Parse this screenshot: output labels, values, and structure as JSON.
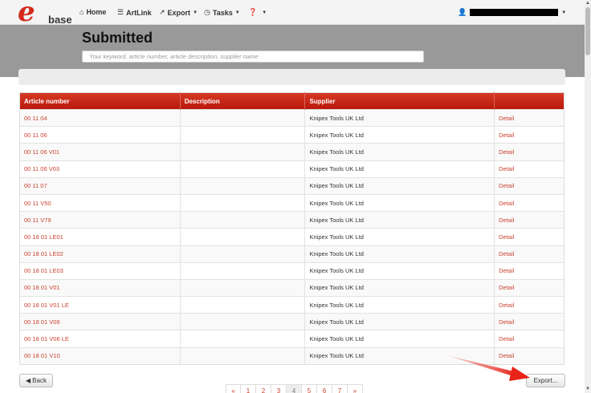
{
  "nav": {
    "logo_mark": "e",
    "logo_text": "base",
    "items": [
      {
        "icon": "home-icon",
        "label": "Home",
        "caret": false
      },
      {
        "icon": "list-icon",
        "label": "ArtLink",
        "caret": false
      },
      {
        "icon": "export-icon",
        "label": "Export",
        "caret": true
      },
      {
        "icon": "clock-icon",
        "label": "Tasks",
        "caret": true
      },
      {
        "icon": "help-icon",
        "label": "",
        "caret": true
      }
    ]
  },
  "page": {
    "title": "Submitted",
    "search_placeholder": "Your keyword, article number, article description, supplier name"
  },
  "table": {
    "headers": [
      "Article number",
      "Description",
      "Supplier",
      ""
    ],
    "detail_label": "Detail",
    "rows": [
      {
        "article": "00 11 04",
        "description": "",
        "supplier": "Knipex Tools UK Ltd"
      },
      {
        "article": "00 11 06",
        "description": "",
        "supplier": "Knipex Tools UK Ltd"
      },
      {
        "article": "00 11 06 V01",
        "description": "",
        "supplier": "Knipex Tools UK Ltd"
      },
      {
        "article": "00 11 06 V03",
        "description": "",
        "supplier": "Knipex Tools UK Ltd"
      },
      {
        "article": "00 11 07",
        "description": "",
        "supplier": "Knipex Tools UK Ltd"
      },
      {
        "article": "00 11 V50",
        "description": "",
        "supplier": "Knipex Tools UK Ltd"
      },
      {
        "article": "00 11 V79",
        "description": "",
        "supplier": "Knipex Tools UK Ltd"
      },
      {
        "article": "00 18 01 LE01",
        "description": "",
        "supplier": "Knipex Tools UK Ltd"
      },
      {
        "article": "00 18 01 LE02",
        "description": "",
        "supplier": "Knipex Tools UK Ltd"
      },
      {
        "article": "00 18 01 LE03",
        "description": "",
        "supplier": "Knipex Tools UK Ltd"
      },
      {
        "article": "00 18 01 V01",
        "description": "",
        "supplier": "Knipex Tools UK Ltd"
      },
      {
        "article": "00 18 01 V01 LE",
        "description": "",
        "supplier": "Knipex Tools UK Ltd"
      },
      {
        "article": "00 18 01 V06",
        "description": "",
        "supplier": "Knipex Tools UK Ltd"
      },
      {
        "article": "00 18 01 V06 LE",
        "description": "",
        "supplier": "Knipex Tools UK Ltd"
      },
      {
        "article": "00 18 01 V10",
        "description": "",
        "supplier": "Knipex Tools UK Ltd"
      }
    ]
  },
  "footer": {
    "back_label": "Back",
    "export_label": "Export...",
    "pager": [
      "«",
      "1",
      "2",
      "3",
      "4",
      "5",
      "6",
      "7",
      "»"
    ],
    "active_page": "4"
  },
  "colors": {
    "accent": "#c9422f",
    "header_red": "#c8200f",
    "band_gray": "#999999",
    "annotation_arrow": "#e8241a"
  }
}
